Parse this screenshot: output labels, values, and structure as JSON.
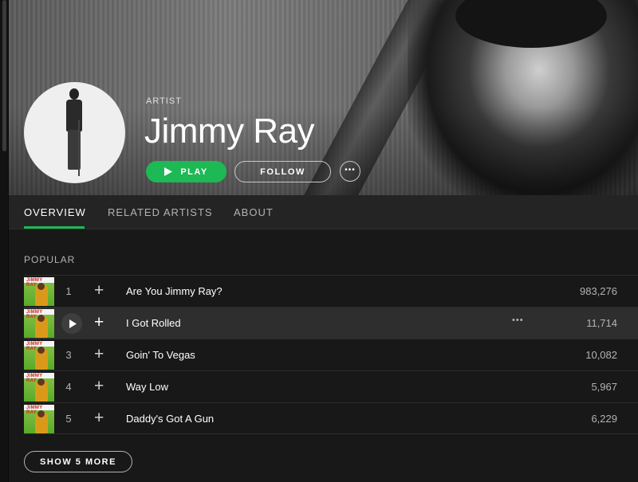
{
  "header": {
    "label": "ARTIST",
    "artist_name": "Jimmy Ray",
    "play_label": "PLAY",
    "follow_label": "FOLLOW",
    "more_label": "•••"
  },
  "tabs": [
    {
      "label": "OVERVIEW",
      "active": true
    },
    {
      "label": "RELATED ARTISTS",
      "active": false
    },
    {
      "label": "ABOUT",
      "active": false
    }
  ],
  "popular": {
    "heading": "POPULAR",
    "cover_text": "JIMMY RAY",
    "tracks": [
      {
        "number": "1",
        "title": "Are You Jimmy Ray?",
        "plays": "983,276"
      },
      {
        "number": "2",
        "title": "I Got Rolled",
        "plays": "11,714",
        "hovered": true,
        "more_label": "•••"
      },
      {
        "number": "3",
        "title": "Goin' To Vegas",
        "plays": "10,082"
      },
      {
        "number": "4",
        "title": "Way Low",
        "plays": "5,967"
      },
      {
        "number": "5",
        "title": "Daddy's Got A Gun",
        "plays": "6,229"
      }
    ],
    "add_symbol": "+",
    "show_more_label": "SHOW 5 MORE"
  },
  "colors": {
    "accent": "#1db954",
    "background": "#181818",
    "tab_bar": "#242424",
    "row_hover": "#2e2e2e"
  },
  "icons": {
    "play": "play-triangle-icon",
    "add": "plus-icon",
    "more": "ellipsis-icon"
  }
}
